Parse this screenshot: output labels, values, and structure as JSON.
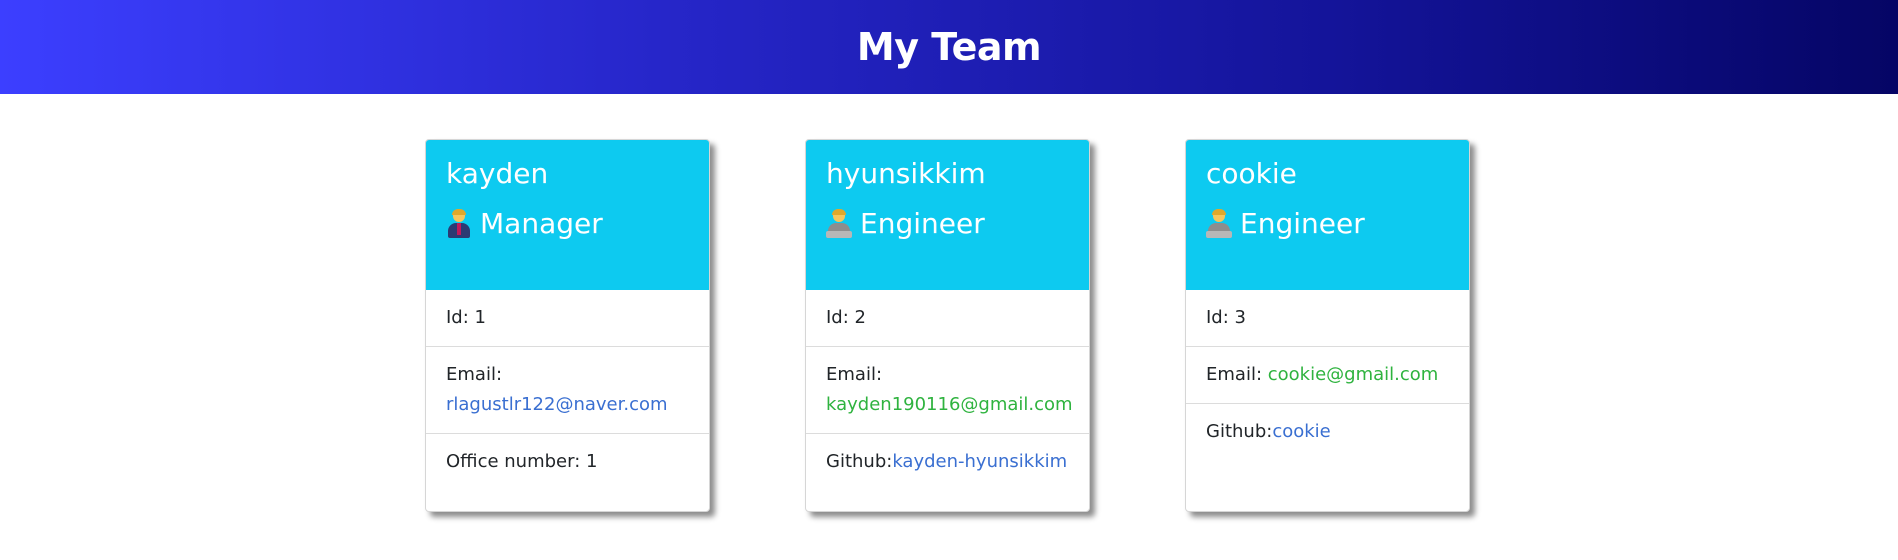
{
  "header": {
    "title": "My Team"
  },
  "cards": [
    {
      "name": "kayden",
      "role": "Manager",
      "role_icon": "manager-icon",
      "id_text": "Id: 1",
      "email_label": "Email:",
      "email": "rlagustlr122@naver.com",
      "extra_label": "Office number: 1",
      "extra_link": ""
    },
    {
      "name": "hyunsikkim",
      "role": "Engineer",
      "role_icon": "engineer-icon",
      "id_text": "Id: 2",
      "email_label": "Email:",
      "email": "kayden190116@gmail.com",
      "extra_label": "Github:",
      "extra_link": "kayden-hyunsikkim"
    },
    {
      "name": "cookie",
      "role": "Engineer",
      "role_icon": "engineer-icon",
      "id_text": "Id: 3",
      "email_label": "Email:",
      "email": "cookie@gmail.com",
      "extra_label": "Github:",
      "extra_link": "cookie"
    }
  ],
  "colors": {
    "header_gradient_start": "#3c3fff",
    "header_gradient_end": "#050565",
    "card_header": "#0dcaf0",
    "email_link_manager": "#3a6fd1",
    "email_link_engineer": "#2fb33f",
    "github_link": "#3a6fd1"
  }
}
